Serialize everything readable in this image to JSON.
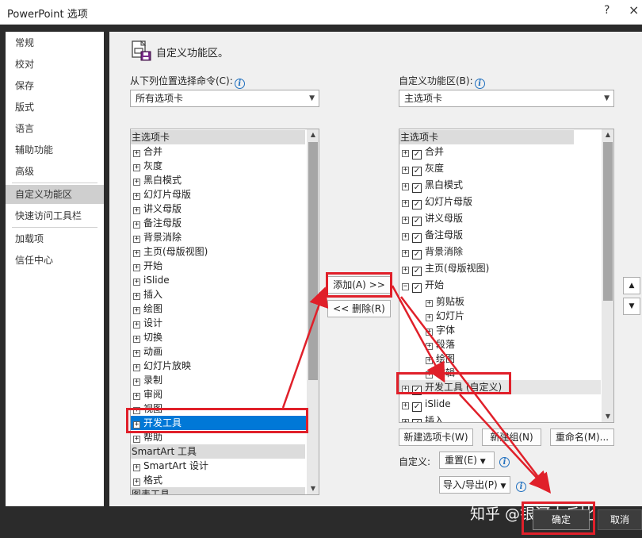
{
  "window": {
    "title": "PowerPoint 选项",
    "help": "?",
    "close": "×"
  },
  "nav": [
    "常规",
    "校对",
    "保存",
    "版式",
    "语言",
    "辅助功能",
    "高级",
    "自定义功能区",
    "快速访问工具栏",
    "加载项",
    "信任中心"
  ],
  "header": {
    "title": "自定义功能区。"
  },
  "left": {
    "label": "从下列位置选择命令(C):",
    "combo": "所有选项卡",
    "rows": [
      {
        "t": "主选项卡",
        "h": true
      },
      {
        "t": "合并"
      },
      {
        "t": "灰度"
      },
      {
        "t": "黑白模式"
      },
      {
        "t": "幻灯片母版"
      },
      {
        "t": "讲义母版"
      },
      {
        "t": "备注母版"
      },
      {
        "t": "背景消除"
      },
      {
        "t": "主页(母版视图)"
      },
      {
        "t": "开始"
      },
      {
        "t": "iSlide"
      },
      {
        "t": "插入"
      },
      {
        "t": "绘图"
      },
      {
        "t": "设计"
      },
      {
        "t": "切换"
      },
      {
        "t": "动画"
      },
      {
        "t": "幻灯片放映"
      },
      {
        "t": "录制"
      },
      {
        "t": "审阅"
      },
      {
        "t": "视图"
      },
      {
        "t": "开发工具",
        "sel": true
      },
      {
        "t": "帮助"
      },
      {
        "t": "SmartArt 工具",
        "h": true
      },
      {
        "t": "SmartArt 设计"
      },
      {
        "t": "格式"
      },
      {
        "t": "图表工具",
        "h": true
      }
    ]
  },
  "middle": {
    "add": "添加(A) >>",
    "remove": "<< 删除(R)"
  },
  "right": {
    "label": "自定义功能区(B):",
    "combo": "主选项卡",
    "rows": [
      {
        "t": "主选项卡",
        "h": true
      },
      {
        "t": "合并",
        "c": true
      },
      {
        "t": "灰度",
        "c": true
      },
      {
        "t": "黑白模式",
        "c": true
      },
      {
        "t": "幻灯片母版",
        "c": true
      },
      {
        "t": "讲义母版",
        "c": true
      },
      {
        "t": "备注母版",
        "c": true
      },
      {
        "t": "背景消除",
        "c": true
      },
      {
        "t": "主页(母版视图)",
        "c": true
      },
      {
        "t": "开始",
        "c": true,
        "open": true
      },
      {
        "t": "剪贴板",
        "sub": true
      },
      {
        "t": "幻灯片",
        "sub": true
      },
      {
        "t": "字体",
        "sub": true
      },
      {
        "t": "段落",
        "sub": true
      },
      {
        "t": "绘图",
        "sub": true
      },
      {
        "t": "编辑",
        "sub": true
      },
      {
        "t": "开发工具 (自定义)",
        "c": true,
        "hl": true
      },
      {
        "t": "iSlide",
        "c": true
      },
      {
        "t": "插入",
        "c": true
      }
    ],
    "new_tab": "新建选项卡(W)",
    "new_group": "新建组(N)",
    "rename": "重命名(M)...",
    "customize_label": "自定义:",
    "reset": "重置(E)",
    "import_export": "导入/导出(P)"
  },
  "footer": {
    "ok": "确定",
    "cancel": "取消",
    "watermark": "知乎 @银河小丘比"
  },
  "colors": {
    "selection": "#0078d7",
    "annotation": "#e0202a",
    "frame": "#2b2b2b"
  }
}
